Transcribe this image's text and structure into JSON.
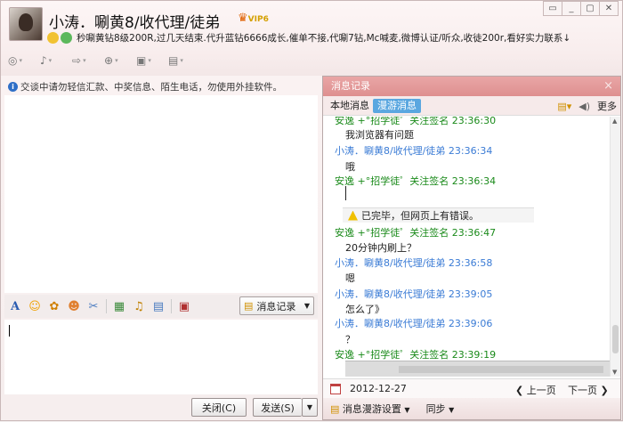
{
  "window": {
    "title": "小涛．唰黄8/收代理/徒弟",
    "vip_badge": "VIP6",
    "signature": "秒唰黄钻8级200R,过几天结束.代升蓝钻6666成长,催单不接,代唰7钻,Mc喊麦,微博认证/听众,收徒200r,看好实力联系↓"
  },
  "toolbar_top": {
    "items": [
      "video-icon",
      "voice-icon",
      "transfer-icon",
      "add-icon",
      "screen-icon",
      "doc-icon"
    ]
  },
  "left": {
    "notice": "交谈中请勿轻信汇款、中奖信息、陌生电话，勿使用外挂软件。",
    "history_button": "消息记录",
    "close_button": "关闭(C)",
    "send_button": "发送(S)"
  },
  "history_panel": {
    "title": "消息记录",
    "tab_local": "本地消息",
    "tab_roam": "漫游消息",
    "more": "更多",
    "messages": [
      {
        "sender": "安逸  +°招学徒゜关注签名",
        "time": "23:36:30",
        "text": "我浏览器有问题"
      },
      {
        "sender": "小涛．唰黄8/收代理/徒弟",
        "time": "23:36:34",
        "text": "哦"
      },
      {
        "sender": "安逸  +°招学徒゜关注签名",
        "time": "23:36:34",
        "text": ""
      },
      {
        "sender": "",
        "time": "",
        "text": "已完毕，但网页上有错误。"
      },
      {
        "sender": "安逸  +°招学徒゜关注签名",
        "time": "23:36:47",
        "text": "20分钟内刷上？"
      },
      {
        "sender": "小涛．唰黄8/收代理/徒弟",
        "time": "23:36:58",
        "text": "嗯"
      },
      {
        "sender": "小涛．唰黄8/收代理/徒弟",
        "time": "23:39:05",
        "text": "怎么了》"
      },
      {
        "sender": "小涛．唰黄8/收代理/徒弟",
        "time": "23:39:06",
        "text": "？"
      },
      {
        "sender": "安逸  +°招学徒゜关注签名",
        "time": "23:39:19",
        "text": ""
      }
    ],
    "date": "2012-12-27",
    "prev_page": "上一页",
    "next_page": "下一页",
    "roam_settings": "消息漫游设置",
    "sync": "同步"
  },
  "colors": {
    "accent_header": "#de8f8f",
    "tab_active": "#5aa7e0",
    "sender_self": "#3a7bd5",
    "sender_other": "#1a8a1a"
  }
}
